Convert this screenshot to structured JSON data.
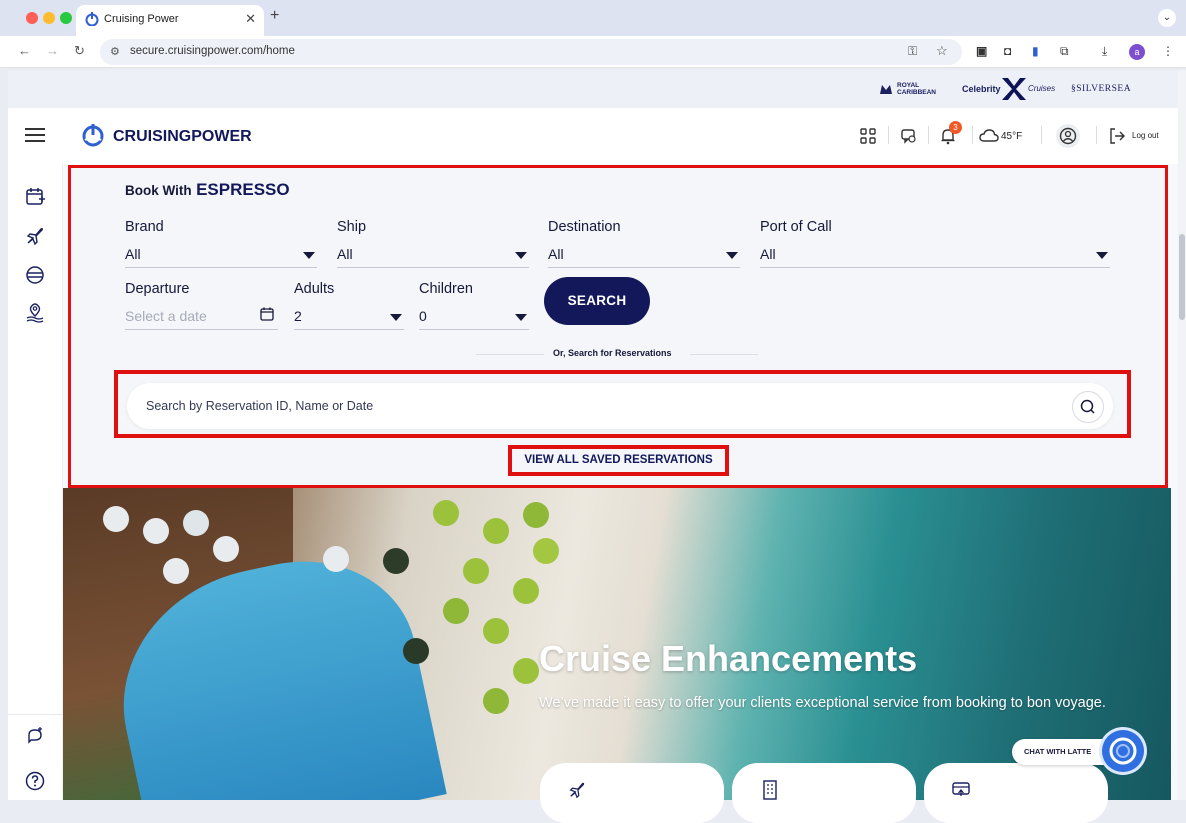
{
  "browser": {
    "tab_title": "Cruising Power",
    "url": "secure.cruisingpower.com/home",
    "profile_initial": "a"
  },
  "brands": {
    "royal": [
      "ROYAL",
      "CARIBBEAN"
    ],
    "celebrity_a": "Celebrity",
    "celebrity_b": "Cruises",
    "silversea": "SILVERSEA"
  },
  "header": {
    "logo_text": "CRUISINGPOWER",
    "notification_count": "3",
    "weather": "45°F",
    "logout_label": "Log out"
  },
  "booking": {
    "book_with": "Book With",
    "espresso": "ESPRESSO",
    "brand_label": "Brand",
    "brand_value": "All",
    "ship_label": "Ship",
    "ship_value": "All",
    "destination_label": "Destination",
    "destination_value": "All",
    "port_label": "Port of Call",
    "port_value": "All",
    "departure_label": "Departure",
    "departure_placeholder": "Select a date",
    "adults_label": "Adults",
    "adults_value": "2",
    "children_label": "Children",
    "children_value": "0",
    "search_button": "SEARCH",
    "or_search": "Or, Search for Reservations",
    "reservation_placeholder": "Search by Reservation ID, Name or Date",
    "view_saved": "VIEW ALL SAVED RESERVATIONS"
  },
  "hero": {
    "title": "Cruise Enhancements",
    "subtitle": "We’ve made it easy to offer your clients exceptional service from booking to bon voyage."
  },
  "chat": {
    "label": "CHAT WITH LATTE"
  },
  "colors": {
    "navy": "#13185a",
    "highlight": "#e01010",
    "accent": "#2f5fd0"
  }
}
